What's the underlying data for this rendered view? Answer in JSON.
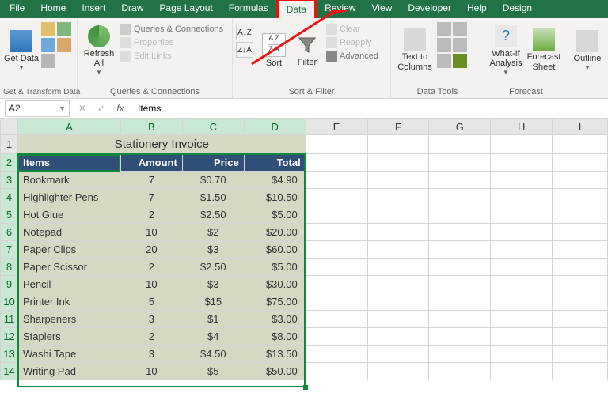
{
  "tabs": {
    "file": "File",
    "home": "Home",
    "insert": "Insert",
    "draw": "Draw",
    "pagelayout": "Page Layout",
    "formulas": "Formulas",
    "data": "Data",
    "review": "Review",
    "view": "View",
    "developer": "Developer",
    "help": "Help",
    "design": "Design"
  },
  "ribbon": {
    "getdata": "Get Data",
    "refreshall": "Refresh All",
    "queries_conn": "Queries & Connections",
    "properties": "Properties",
    "editlinks": "Edit Links",
    "group_gettransform": "Get & Transform Data",
    "group_queries": "Queries & Connections",
    "sort": "Sort",
    "filter": "Filter",
    "clear": "Clear",
    "reapply": "Reapply",
    "advanced": "Advanced",
    "group_sortfilter": "Sort & Filter",
    "texttocolumns": "Text to Columns",
    "group_datatools": "Data Tools",
    "whatif": "What-If Analysis",
    "forecastsheet": "Forecast Sheet",
    "group_forecast": "Forecast",
    "outline": "Outline"
  },
  "formula_bar": {
    "namebox": "A2",
    "value": "Items"
  },
  "cols": [
    "A",
    "B",
    "C",
    "D",
    "E",
    "F",
    "G",
    "H",
    "I"
  ],
  "title": "Stationery Invoice",
  "headers": {
    "a": "Items",
    "b": "Amount",
    "c": "Price",
    "d": "Total"
  },
  "rows": [
    {
      "item": "Bookmark",
      "amt": "7",
      "price": "$0.70",
      "total": "$4.90"
    },
    {
      "item": "Highlighter Pens",
      "amt": "7",
      "price": "$1.50",
      "total": "$10.50"
    },
    {
      "item": "Hot Glue",
      "amt": "2",
      "price": "$2.50",
      "total": "$5.00"
    },
    {
      "item": "Notepad",
      "amt": "10",
      "price": "$2",
      "total": "$20.00"
    },
    {
      "item": "Paper Clips",
      "amt": "20",
      "price": "$3",
      "total": "$60.00"
    },
    {
      "item": "Paper Scissor",
      "amt": "2",
      "price": "$2.50",
      "total": "$5.00"
    },
    {
      "item": "Pencil",
      "amt": "10",
      "price": "$3",
      "total": "$30.00"
    },
    {
      "item": "Printer Ink",
      "amt": "5",
      "price": "$15",
      "total": "$75.00"
    },
    {
      "item": "Sharpeners",
      "amt": "3",
      "price": "$1",
      "total": "$3.00"
    },
    {
      "item": "Staplers",
      "amt": "2",
      "price": "$4",
      "total": "$8.00"
    },
    {
      "item": "Washi Tape",
      "amt": "3",
      "price": "$4.50",
      "total": "$13.50"
    },
    {
      "item": "Writing Pad",
      "amt": "10",
      "price": "$5",
      "total": "$50.00"
    }
  ],
  "chart_data": {
    "type": "table",
    "title": "Stationery Invoice",
    "columns": [
      "Items",
      "Amount",
      "Price",
      "Total"
    ],
    "data": [
      [
        "Bookmark",
        7,
        0.7,
        4.9
      ],
      [
        "Highlighter Pens",
        7,
        1.5,
        10.5
      ],
      [
        "Hot Glue",
        2,
        2.5,
        5.0
      ],
      [
        "Notepad",
        10,
        2,
        20.0
      ],
      [
        "Paper Clips",
        20,
        3,
        60.0
      ],
      [
        "Paper Scissor",
        2,
        2.5,
        5.0
      ],
      [
        "Pencil",
        10,
        3,
        30.0
      ],
      [
        "Printer Ink",
        5,
        15,
        75.0
      ],
      [
        "Sharpeners",
        3,
        1,
        3.0
      ],
      [
        "Staplers",
        2,
        4,
        8.0
      ],
      [
        "Washi Tape",
        3,
        4.5,
        13.5
      ],
      [
        "Writing Pad",
        10,
        5,
        50.0
      ]
    ]
  }
}
